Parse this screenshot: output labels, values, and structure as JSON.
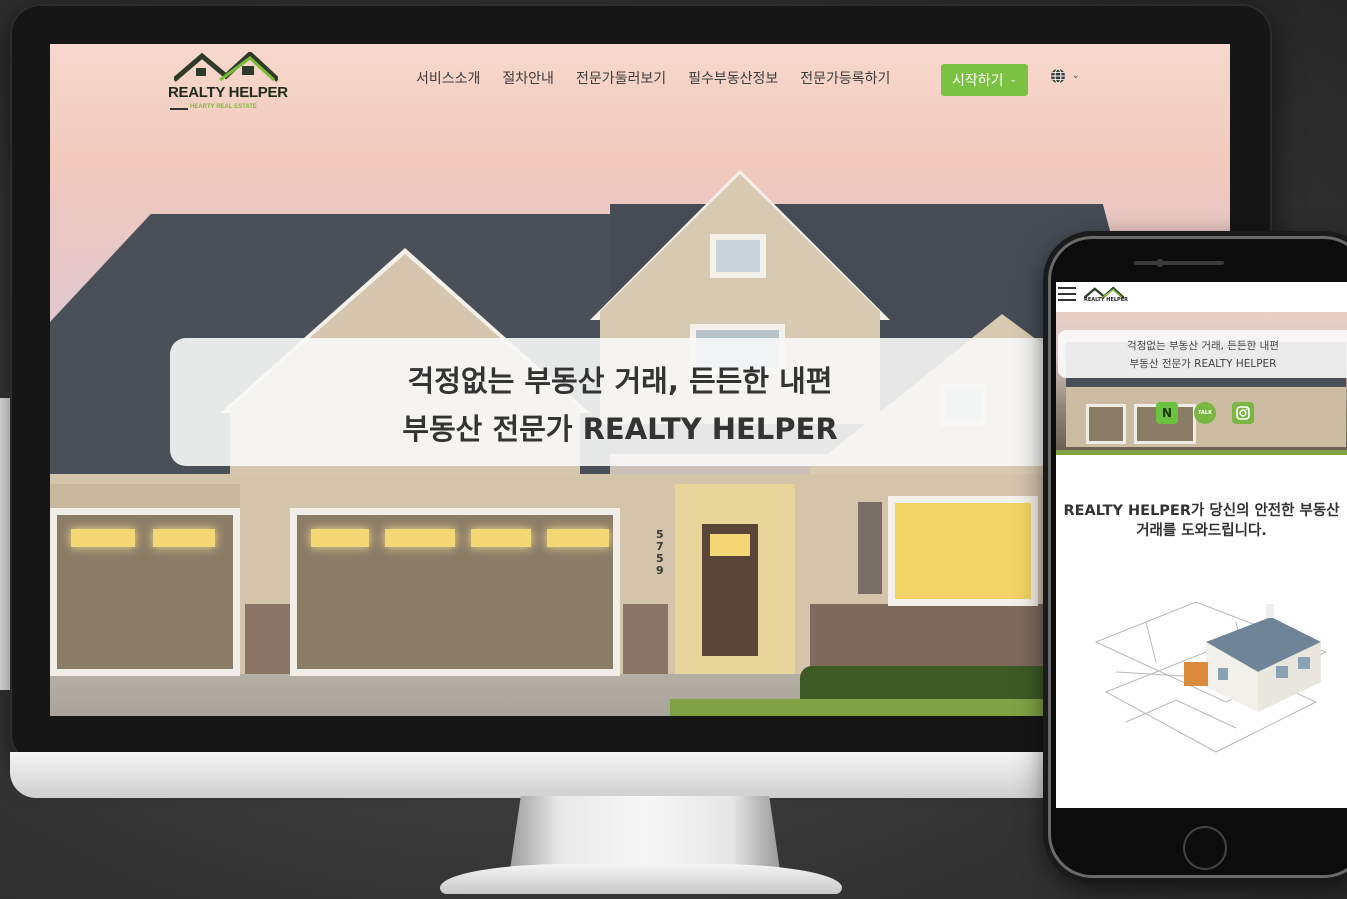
{
  "desktop": {
    "logo": {
      "name": "REALTY HELPER",
      "tagline": "HEARTY REAL ESTATE"
    },
    "nav": {
      "items": [
        "서비스소개",
        "절차안내",
        "전문가둘러보기",
        "필수부동산정보",
        "전문가등록하기"
      ],
      "start_button": "시작하기",
      "language_icon": "globe-icon"
    },
    "hero": {
      "line1": "걱정없는 부동산 거래, 든든한 내편",
      "line2": "부동산 전문가 REALTY HELPER"
    },
    "house_number": "5759"
  },
  "mobile": {
    "logo": {
      "name": "REALTY HELPER"
    },
    "hero": {
      "line1": "걱정없는 부동산 거래, 든든한 내편",
      "line2": "부동산 전문가 REALTY HELPER"
    },
    "social": [
      {
        "icon": "naver-icon",
        "label": "N"
      },
      {
        "icon": "kakao-talk-icon",
        "label": "TALK"
      },
      {
        "icon": "instagram-icon"
      }
    ],
    "headline_line1": "REALTY HELPER가 당신의 안전한 부동산",
    "headline_line2": "거래를 도와드립니다."
  },
  "colors": {
    "accent_green": "#7bc142",
    "background": "#333333",
    "text_dark": "#333333"
  }
}
